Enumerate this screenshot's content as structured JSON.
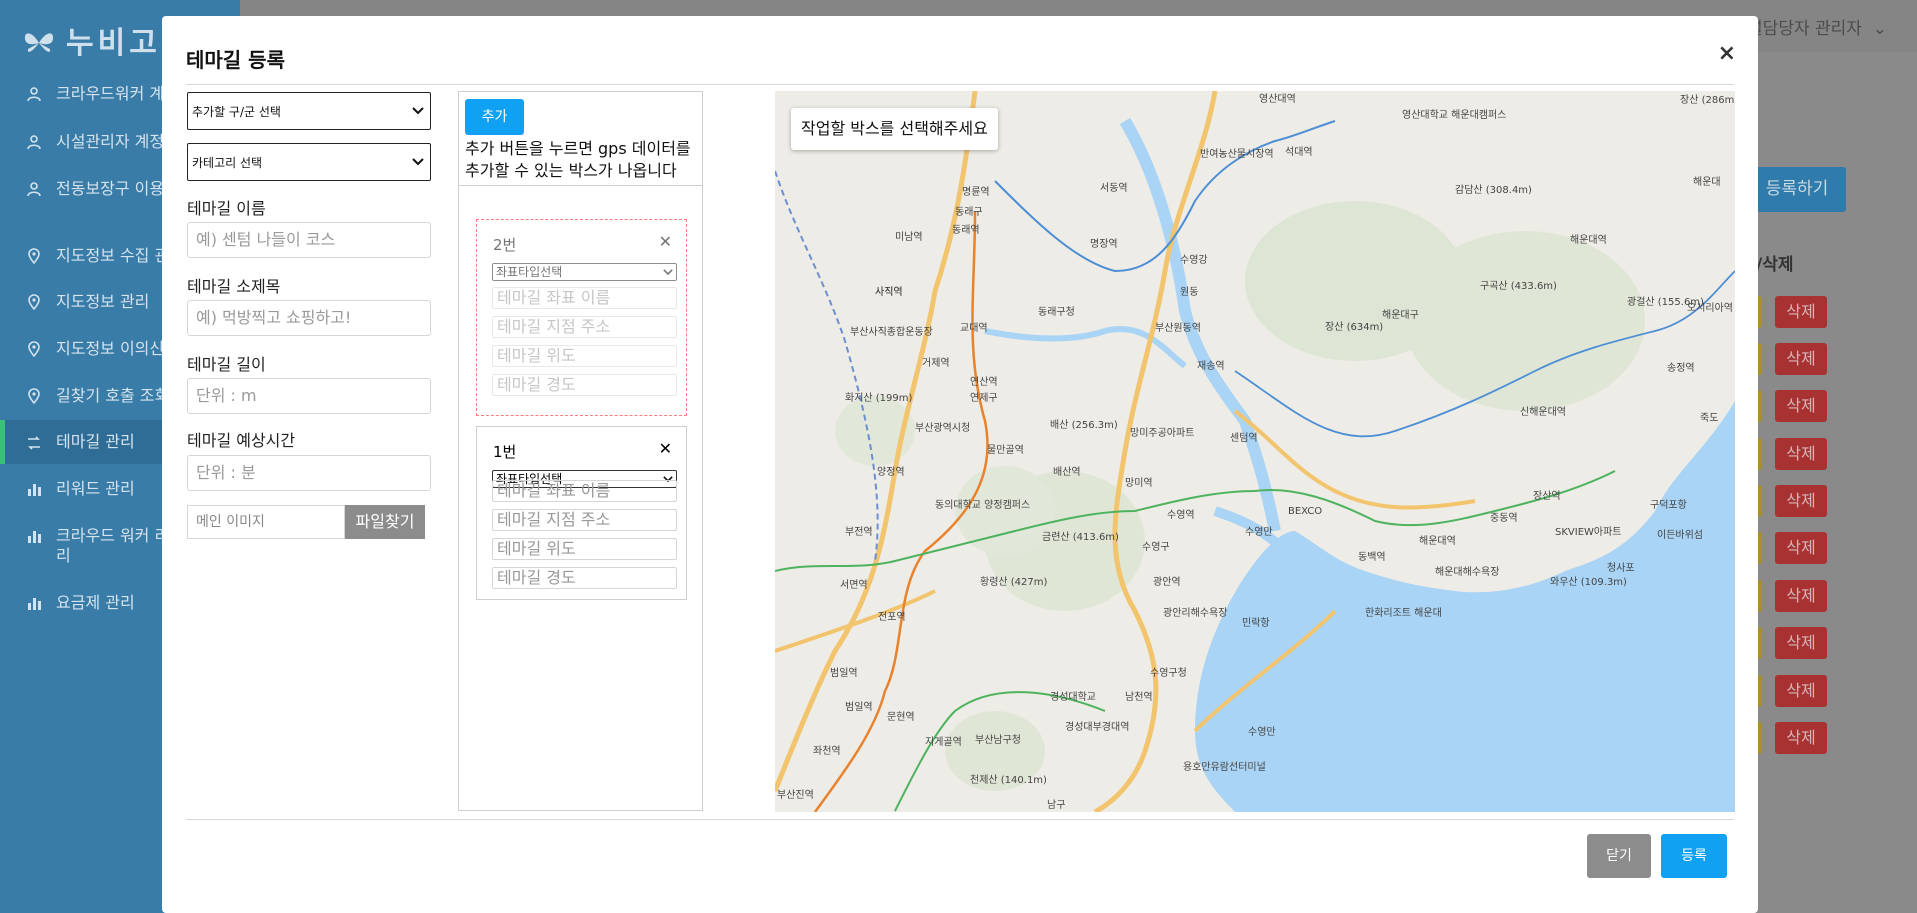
{
  "app": {
    "logo": "누비고",
    "user": "시설담당자 관리자",
    "register_button": "등록하기",
    "column_delete": "/삭제",
    "delete_label": "삭제"
  },
  "sidebar": {
    "items": [
      {
        "label": "크라우드워커 계정관리",
        "icon": "user-icon"
      },
      {
        "label": "시설관리자 계정관리",
        "icon": "user-icon"
      },
      {
        "label": "전동보장구 이용자 관리",
        "icon": "user-icon"
      },
      {
        "label": "지도정보 수집 관리",
        "icon": "map-pin-icon"
      },
      {
        "label": "지도정보 관리",
        "icon": "map-pin-icon"
      },
      {
        "label": "지도정보 이의신청 관리",
        "icon": "map-pin-icon"
      },
      {
        "label": "길찾기 호출 조회",
        "icon": "map-pin-icon"
      },
      {
        "label": "테마길 관리",
        "icon": "route-icon"
      },
      {
        "label": "리워드 관리",
        "icon": "bar-chart-icon"
      },
      {
        "label": "크라우드 워커 리워드 관리",
        "icon": "bar-chart-icon"
      },
      {
        "label": "요금제 관리",
        "icon": "bar-chart-icon"
      }
    ]
  },
  "modal": {
    "title": "테마길 등록",
    "close": "×",
    "district_select": "추가할 구/군 선택",
    "category_select": "카테고리 선택",
    "name_label": "테마길 이름",
    "name_placeholder": "예) 센텀 나들이 코스",
    "subtitle_label": "테마길 소제목",
    "subtitle_placeholder": "예) 먹방찍고 쇼핑하고!",
    "length_label": "테마길 길이",
    "length_placeholder": "단위 : m",
    "time_label": "테마길 예상시간",
    "time_placeholder": "단위 : 분",
    "image_placeholder": "메인 이미지",
    "file_button": "파일찾기",
    "add_button": "추가",
    "add_hint": "추가 버튼을 누르면 gps 데이터를 추가할 수 있는 박스가 나옵니다",
    "gps_boxes": [
      {
        "number": "2번",
        "type_select": "좌표타입선택",
        "coord_name": "테마길 좌표 이름",
        "address": "테마길 지점 주소",
        "lat": "테마길 위도",
        "lng": "테마길 경도"
      },
      {
        "number": "1번",
        "type_select": "좌표타입선택",
        "coord_name": "테마길 좌표 이름",
        "address": "테마길 지점 주소",
        "lat": "테마길 위도",
        "lng": "테마길 경도"
      }
    ],
    "map_message": "작업할 박스를 선택해주세요",
    "close_button": "닫기",
    "submit_button": "등록"
  },
  "map_labels": [
    "영산대역",
    "영산대학교 해운대캠퍼스",
    "장산 (286m)",
    "반여농산물시장역",
    "석대역",
    "서동역",
    "명륜역",
    "동래역",
    "미남역",
    "동래구",
    "명장역",
    "수영강",
    "원동",
    "해운대역",
    "감담산 (308.4m)",
    "사직역",
    "교대역",
    "동래구청",
    "부산원동역",
    "구곡산 (433.6m)",
    "장산 (634m)",
    "해운대구",
    "광걸산 (155.6m)",
    "부산사직종합운동장",
    "거제역",
    "재송역",
    "연산역",
    "연제구",
    "화지산 (199m)",
    "배산 (256.3m)",
    "망미주공아파트",
    "센텀역",
    "신해운대역",
    "송정역",
    "부산광역시청",
    "물만골역",
    "배산역",
    "망미역",
    "양정역",
    "동의대학교 양정캠퍼스",
    "수영역",
    "수영만",
    "BEXCO",
    "장산역",
    "중동역",
    "SKVIEW아파트",
    "구덕포항",
    "이든바위섬",
    "금련산 (413.6m)",
    "수영구",
    "부전역",
    "동백역",
    "해운대역",
    "해운대해수욕장",
    "청사포",
    "와우산 (109.3m)",
    "황령산 (427m)",
    "광안역",
    "서면역",
    "전포역",
    "광안리해수욕장",
    "민락항",
    "한화리조트 해운대",
    "범일역",
    "수영구청",
    "남천역",
    "경성대학교",
    "문현역",
    "범일역",
    "경성대부경대역",
    "지게골역",
    "부산남구청",
    "좌천역",
    "천제산 (140.1m)",
    "용호만유람선터미널",
    "남구",
    "부산진역",
    "수영만",
    "해운대",
    "오시리아역",
    "죽도",
    "사직역"
  ],
  "colors": {
    "accent": "#11a1f2",
    "gray_button": "#8c8c8c",
    "delete_red": "#a83232",
    "dashed_select": "#ff7b7b",
    "sidebar_bg": "#3a7ca8"
  }
}
